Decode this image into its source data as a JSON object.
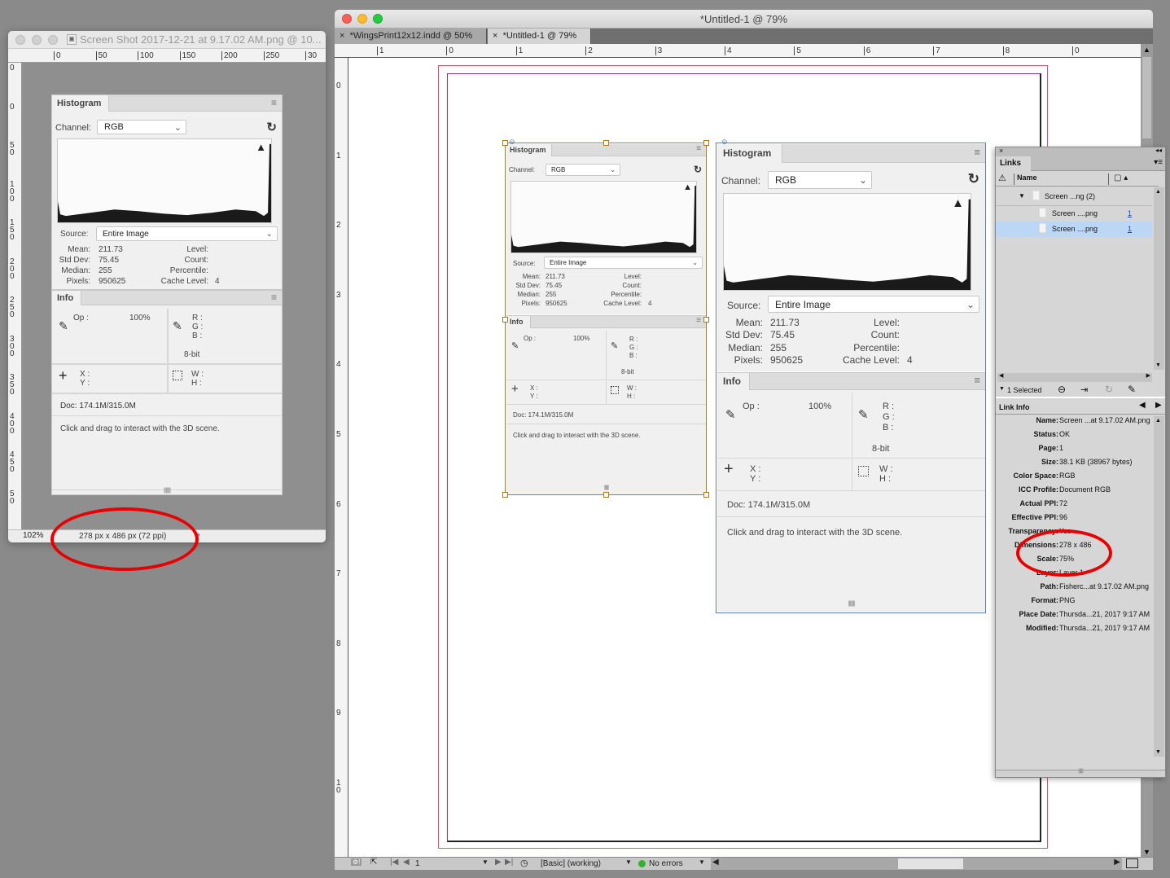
{
  "photoshop_window": {
    "title": "Screen Shot 2017-12-21 at 9.17.02 AM.png @ 10...",
    "h_ruler_labels": [
      "0",
      "50",
      "100",
      "150",
      "200",
      "250",
      "30"
    ],
    "v_ruler_labels": [
      "0",
      "0",
      "50",
      "100",
      "150",
      "200",
      "250",
      "300",
      "350",
      "400",
      "450",
      "50"
    ],
    "status": {
      "zoom": "102%",
      "dimensions": "278 px x 486 px (72 ppi)",
      "arrow": "›"
    }
  },
  "histogram_panel": {
    "tab": "Histogram",
    "channel_label": "Channel:",
    "channel_value": "RGB",
    "source_label": "Source:",
    "source_value": "Entire Image",
    "stats": {
      "mean_label": "Mean:",
      "mean": "211.73",
      "stddev_label": "Std Dev:",
      "stddev": "75.45",
      "median_label": "Median:",
      "median": "255",
      "pixels_label": "Pixels:",
      "pixels": "950625",
      "level_label": "Level:",
      "count_label": "Count:",
      "percentile_label": "Percentile:",
      "cache_label": "Cache Level:",
      "cache": "4"
    }
  },
  "info_panel": {
    "tab": "Info",
    "op_label": "Op :",
    "op_value": "100%",
    "r_label": "R :",
    "g_label": "G :",
    "b_label": "B :",
    "bit_depth": "8-bit",
    "x_label": "X :",
    "y_label": "Y :",
    "w_label": "W :",
    "h_label": "H :",
    "doc": "Doc: 174.1M/315.0M",
    "hint": "Click and drag to interact with the 3D scene."
  },
  "indesign_window": {
    "title": "*Untitled-1 @ 79%",
    "tabs": [
      {
        "label": "*WingsPrint12x12.indd @ 50%",
        "close": "×",
        "active": false
      },
      {
        "label": "*Untitled-1 @ 79%",
        "close": "×",
        "active": true
      }
    ],
    "h_ruler_labels": [
      "1",
      "0",
      "1",
      "2",
      "3",
      "4",
      "5",
      "6",
      "7",
      "8",
      "0",
      "1"
    ],
    "v_ruler_labels": [
      "0",
      "1",
      "2",
      "3",
      "4",
      "5",
      "6",
      "7",
      "8",
      "9",
      "10"
    ],
    "status": {
      "page": "1",
      "preflight_profile": "[Basic] (working)",
      "errors": "No errors"
    }
  },
  "links_panel": {
    "tab": "Links",
    "column_name": "Name",
    "items": [
      {
        "name": "Screen ...ng (2)",
        "page": "",
        "group": true
      },
      {
        "name": "Screen ....png",
        "page": "1",
        "selected": false
      },
      {
        "name": "Screen ....png",
        "page": "1",
        "selected": true
      }
    ],
    "selected_count": "1 Selected",
    "link_info_title": "Link Info",
    "link_info": [
      {
        "key": "Name:",
        "value": "Screen ...at 9.17.02 AM.png"
      },
      {
        "key": "Status:",
        "value": "OK"
      },
      {
        "key": "Page:",
        "value": "1"
      },
      {
        "key": "Size:",
        "value": "38.1 KB (38967 bytes)"
      },
      {
        "key": "Color Space:",
        "value": "RGB"
      },
      {
        "key": "ICC Profile:",
        "value": "Document RGB"
      },
      {
        "key": "Actual PPI:",
        "value": "72"
      },
      {
        "key": "Effective PPI:",
        "value": "96"
      },
      {
        "key": "Transparency:",
        "value": "Yes"
      },
      {
        "key": "Dimensions:",
        "value": "278 x 486"
      },
      {
        "key": "Scale:",
        "value": "75%"
      },
      {
        "key": "Layer:",
        "value": "Layer 1"
      },
      {
        "key": "Path:",
        "value": "Fisherc...at 9.17.02 AM.png"
      },
      {
        "key": "Format:",
        "value": "PNG"
      },
      {
        "key": "Place Date:",
        "value": "Thursda...21, 2017 9:17 AM"
      },
      {
        "key": "Modified:",
        "value": "Thursda...21, 2017 9:17 AM"
      }
    ]
  },
  "colors": {
    "frame_selected": "#b07a1a",
    "frame_link": "#5b7fb5",
    "margin_guide": "#8a2bd0",
    "bleed_guide": "#e8505a",
    "annotation": "#e80000",
    "selected_row": "#bcd6f5"
  }
}
